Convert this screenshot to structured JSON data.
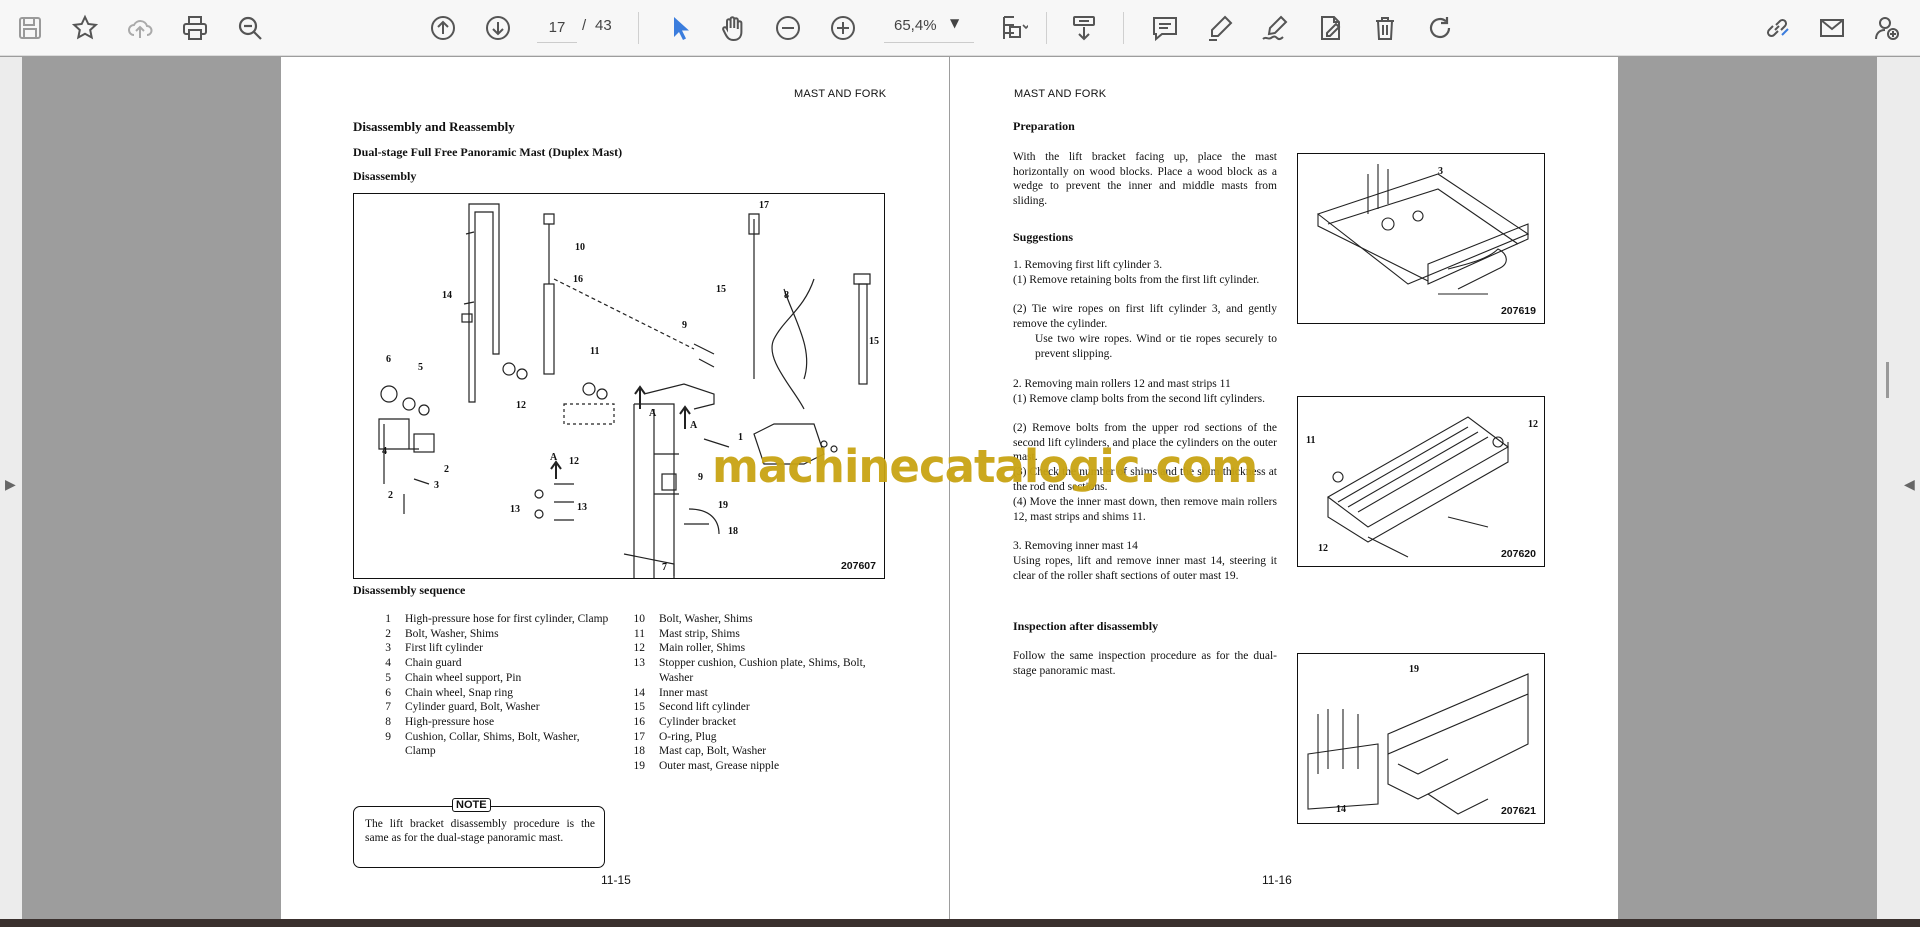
{
  "toolbar": {
    "current_page": "17",
    "page_separator": "/",
    "total_pages": "43",
    "zoom": "65,4%"
  },
  "icons": [
    "save-icon",
    "bookmark-star-icon",
    "cloud-upload-icon",
    "print-icon",
    "zoom-search-icon",
    "page-up-icon",
    "page-down-icon",
    "select-cursor-icon",
    "hand-tool-icon",
    "zoom-out-icon",
    "zoom-in-icon",
    "page-fit-icon",
    "scroll-mode-icon",
    "comment-icon",
    "highlight-pen-icon",
    "signature-icon",
    "edit-document-icon",
    "delete-icon",
    "rotate-icon",
    "share-link-icon",
    "email-icon",
    "add-user-icon"
  ],
  "colors": {
    "accent": "#3b7ddd",
    "watermark": "#c9a414"
  },
  "watermark": "machinecatalogic.com",
  "left_page": {
    "header": "MAST AND FORK",
    "title": "Disassembly and Reassembly",
    "subtitle": "Dual-stage Full Free Panoramic Mast (Duplex Mast)",
    "section": "Disassembly",
    "figure_number": "207607",
    "figure_callouts": [
      "17",
      "10",
      "16",
      "14",
      "15",
      "8",
      "9",
      "6",
      "5",
      "11",
      "15",
      "12",
      "1",
      "A",
      "A",
      "4",
      "2",
      "3",
      "A",
      "12",
      "2",
      "9",
      "13",
      "13",
      "19",
      "18",
      "7"
    ],
    "sequence_title": "Disassembly sequence",
    "sequence": [
      {
        "n": "1",
        "text": "High-pressure hose for first cylinder, Clamp"
      },
      {
        "n": "2",
        "text": "Bolt, Washer, Shims"
      },
      {
        "n": "3",
        "text": "First lift cylinder"
      },
      {
        "n": "4",
        "text": "Chain guard"
      },
      {
        "n": "5",
        "text": "Chain wheel support, Pin"
      },
      {
        "n": "6",
        "text": "Chain wheel, Snap ring"
      },
      {
        "n": "7",
        "text": "Cylinder guard, Bolt, Washer"
      },
      {
        "n": "8",
        "text": "High-pressure hose"
      },
      {
        "n": "9",
        "text": "Cushion, Collar, Shims, Bolt, Washer, Clamp"
      },
      {
        "n": "10",
        "text": "Bolt, Washer, Shims"
      },
      {
        "n": "11",
        "text": "Mast strip, Shims"
      },
      {
        "n": "12",
        "text": "Main roller, Shims"
      },
      {
        "n": "13",
        "text": "Stopper cushion, Cushion plate, Shims, Bolt, Washer"
      },
      {
        "n": "14",
        "text": "Inner mast"
      },
      {
        "n": "15",
        "text": "Second lift cylinder"
      },
      {
        "n": "16",
        "text": "Cylinder bracket"
      },
      {
        "n": "17",
        "text": "O-ring, Plug"
      },
      {
        "n": "18",
        "text": "Mast cap, Bolt, Washer"
      },
      {
        "n": "19",
        "text": "Outer mast, Grease nipple"
      }
    ],
    "note_label": "NOTE",
    "note_text": "The lift bracket disassembly procedure is the same as for the dual-stage panoramic mast.",
    "page_number": "11-15"
  },
  "right_page": {
    "header": "MAST AND FORK",
    "preparation_title": "Preparation",
    "preparation_text": "With the lift bracket facing up, place the mast horizontally on wood blocks. Place a wood block as a wedge to prevent the inner and middle masts from sliding.",
    "suggestions_title": "Suggestions",
    "step1": "1.  Removing first lift cylinder 3.",
    "step1_1": "(1)  Remove retaining bolts from the first lift cylinder.",
    "step1_2": "(2)  Tie wire ropes on first lift cylinder 3, and gently remove the cylinder.",
    "step1_2b": "Use two wire ropes. Wind or tie ropes securely to prevent slipping.",
    "step2": "2.  Removing main rollers 12 and mast strips 11",
    "step2_1": "(1)  Remove clamp bolts from the second lift cylinders.",
    "step2_2": "(2)  Remove bolts from the upper rod sections of the second lift cylinders, and place the cylinders on the outer mast.",
    "step2_3": "(3)  Check the number of shims and the shim thickness at the rod end sections.",
    "step2_4": "(4)  Move the inner mast down, then remove main rollers 12, mast strips and shims 11.",
    "step3": "3.  Removing inner mast 14",
    "step3_text": "Using ropes, lift and remove inner mast 14, steering it clear of the roller shaft sections of outer mast 19.",
    "inspection_title": "Inspection after disassembly",
    "inspection_text": "Follow the same inspection procedure as for the dual-stage panoramic mast.",
    "fig1": {
      "number": "207619",
      "callout": "3"
    },
    "fig2": {
      "number": "207620",
      "callouts": [
        "11",
        "12",
        "12"
      ]
    },
    "fig3": {
      "number": "207621",
      "callouts": [
        "19",
        "14"
      ]
    },
    "page_number": "11-16"
  }
}
